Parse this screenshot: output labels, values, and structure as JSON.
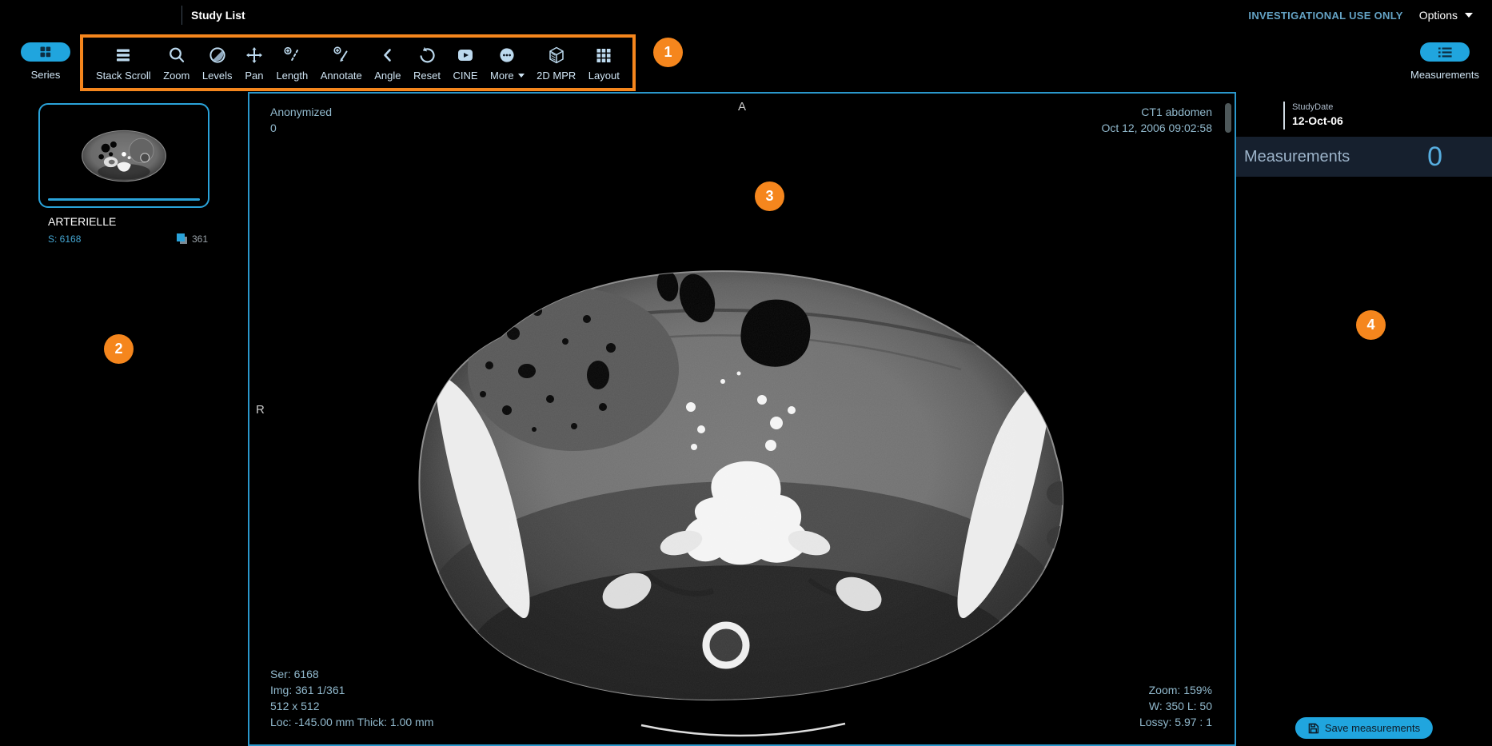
{
  "topbar": {
    "study_list": "Study List",
    "investigational": "INVESTIGATIONAL USE ONLY",
    "options": "Options"
  },
  "toolbar": {
    "series_label": "Series",
    "measurements_label": "Measurements",
    "tools": [
      {
        "label": "Stack Scroll"
      },
      {
        "label": "Zoom"
      },
      {
        "label": "Levels"
      },
      {
        "label": "Pan"
      },
      {
        "label": "Length"
      },
      {
        "label": "Annotate"
      },
      {
        "label": "Angle"
      },
      {
        "label": "Reset"
      },
      {
        "label": "CINE"
      },
      {
        "label": "More"
      },
      {
        "label": "2D MPR"
      },
      {
        "label": "Layout"
      }
    ]
  },
  "sidebar": {
    "series": {
      "title": "ARTERIELLE",
      "series_number": "S: 6168",
      "instance_count": "361"
    }
  },
  "viewport": {
    "overlay_top_left": [
      "Anonymized",
      "0"
    ],
    "overlay_top_right": [
      "CT1 abdomen",
      "Oct 12, 2006 09:02:58"
    ],
    "overlay_bottom_left": [
      "Ser: 6168",
      "Img: 361 1/361",
      "512 x 512",
      "Loc: -145.00 mm Thick: 1.00 mm"
    ],
    "overlay_bottom_right": [
      "Zoom: 159%",
      "W: 350 L: 50",
      "Lossy: 5.97 : 1"
    ],
    "orientation_top": "A",
    "orientation_left": "R"
  },
  "right_panel": {
    "study_date_label": "StudyDate",
    "study_date_value": "12-Oct-06",
    "header_title": "Measurements",
    "count": "0",
    "save_button": "Save measurements"
  },
  "annotations": {
    "callouts": [
      {
        "label": "1"
      },
      {
        "label": "2"
      },
      {
        "label": "3"
      },
      {
        "label": "4"
      }
    ],
    "color": "#F5861D"
  },
  "colors": {
    "accent_cyan": "#20a5de",
    "annotation_orange": "#F5861D",
    "overlay_text": "#91b9cd",
    "viewport_border": "#2a97cb",
    "measurements_header_bg": "#16202e"
  }
}
